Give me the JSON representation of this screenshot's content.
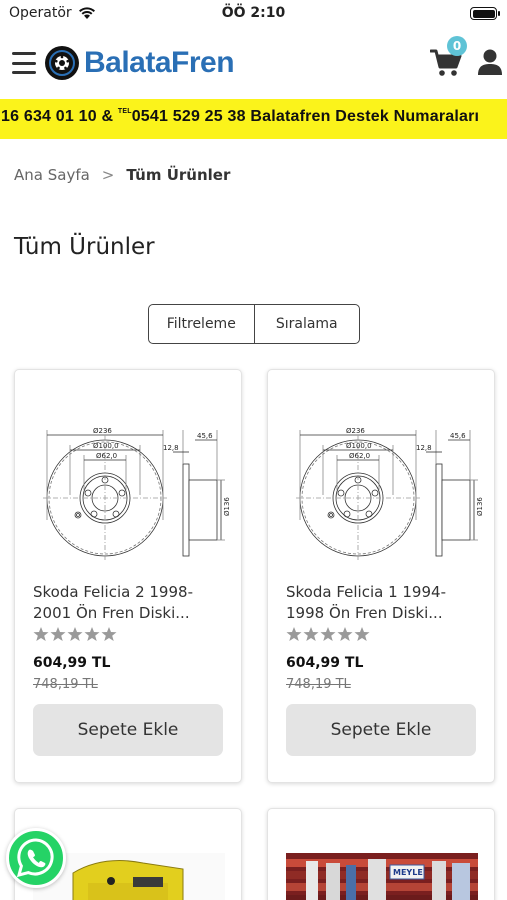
{
  "status": {
    "carrier": "Operatör",
    "time": "ÖÖ 2:10"
  },
  "header": {
    "logo_text": "BalataFren",
    "cart_count": "0",
    "brand_color": "#2a6fb5",
    "badge_color": "#5fc3d6"
  },
  "ticker": {
    "part1": "16 634 01 10 & ",
    "tel_label": "TEL",
    "part2": "0541 529 25 38 Balatafren Destek Numaraları",
    "background": "#fbf31b"
  },
  "breadcrumb": {
    "home": "Ana Sayfa",
    "separator": ">",
    "current": "Tüm Ürünler"
  },
  "page": {
    "title": "Tüm Ürünler"
  },
  "toolbar": {
    "filter_label": "Filtreleme",
    "sort_label": "Sıralama"
  },
  "products": [
    {
      "name": "Skoda Felicia 2 1998-2001 Ön Fren Diski...",
      "price": "604,99 TL",
      "old_price": "748,19 TL",
      "rating": 0,
      "button_label": "Sepete Ekle"
    },
    {
      "name": "Skoda Felicia 1 1994-1998 Ön Fren Diski...",
      "price": "604,99 TL",
      "old_price": "748,19 TL",
      "rating": 0,
      "button_label": "Sepete Ekle"
    }
  ],
  "drawing_labels": {
    "d236": "Ø236",
    "d100": "Ø100,0",
    "d62": "Ø62,0",
    "w456": "45,6",
    "w128": "12,8",
    "d136": "Ø136"
  },
  "brand_box_text": "MEYLE",
  "icons": {
    "menu": "hamburger-icon",
    "cart": "cart-icon",
    "user": "user-icon",
    "whatsapp": "whatsapp-icon",
    "star": "star-icon"
  }
}
